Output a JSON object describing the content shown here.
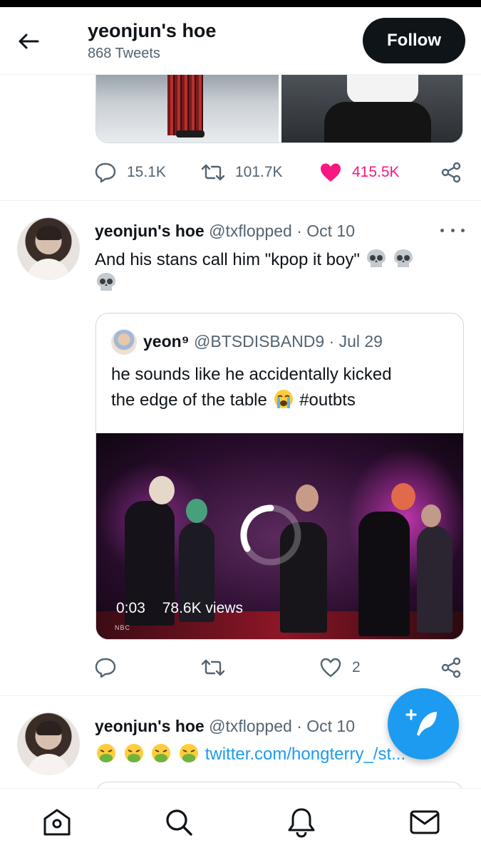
{
  "header": {
    "title": "yeonjun's hoe",
    "subtitle": "868 Tweets",
    "follow_label": "Follow"
  },
  "tweet1": {
    "replies": "15.1K",
    "retweets": "101.7K",
    "likes": "415.5K",
    "liked": true
  },
  "tweet2": {
    "name": "yeonjun's hoe",
    "handle": "@txflopped",
    "sep": "·",
    "date": "Oct 10",
    "text": "And his stans call him \"kpop it boy\"",
    "emojis": [
      "skull",
      "skull",
      "skull"
    ],
    "quote": {
      "name": "yeon⁹",
      "handle": "@BTSDISBAND9",
      "sep": "·",
      "date": "Jul 29",
      "text_line1": "he sounds like he accidentally kicked",
      "text_line2": "the edge of the table",
      "emoji": "loudly-crying-face",
      "hashtag": "#outbts",
      "video_time": "0:03",
      "video_views": "78.6K views",
      "video_brand": "NBC"
    },
    "replies": "",
    "retweets": "",
    "likes": "2"
  },
  "tweet3": {
    "name": "yeonjun's hoe",
    "handle": "@txflopped",
    "sep": "·",
    "date": "Oct 10",
    "emojis": [
      "nauseated-face",
      "nauseated-face",
      "nauseated-face",
      "nauseated-face"
    ],
    "link": "twitter.com/hongterry_/st..."
  },
  "nav": {
    "items": [
      "home-icon",
      "search-icon",
      "notifications-icon",
      "messages-icon"
    ]
  },
  "colors": {
    "accent": "#1d9bf0",
    "like": "#f91880",
    "text": "#0f1419",
    "muted": "#536471"
  }
}
